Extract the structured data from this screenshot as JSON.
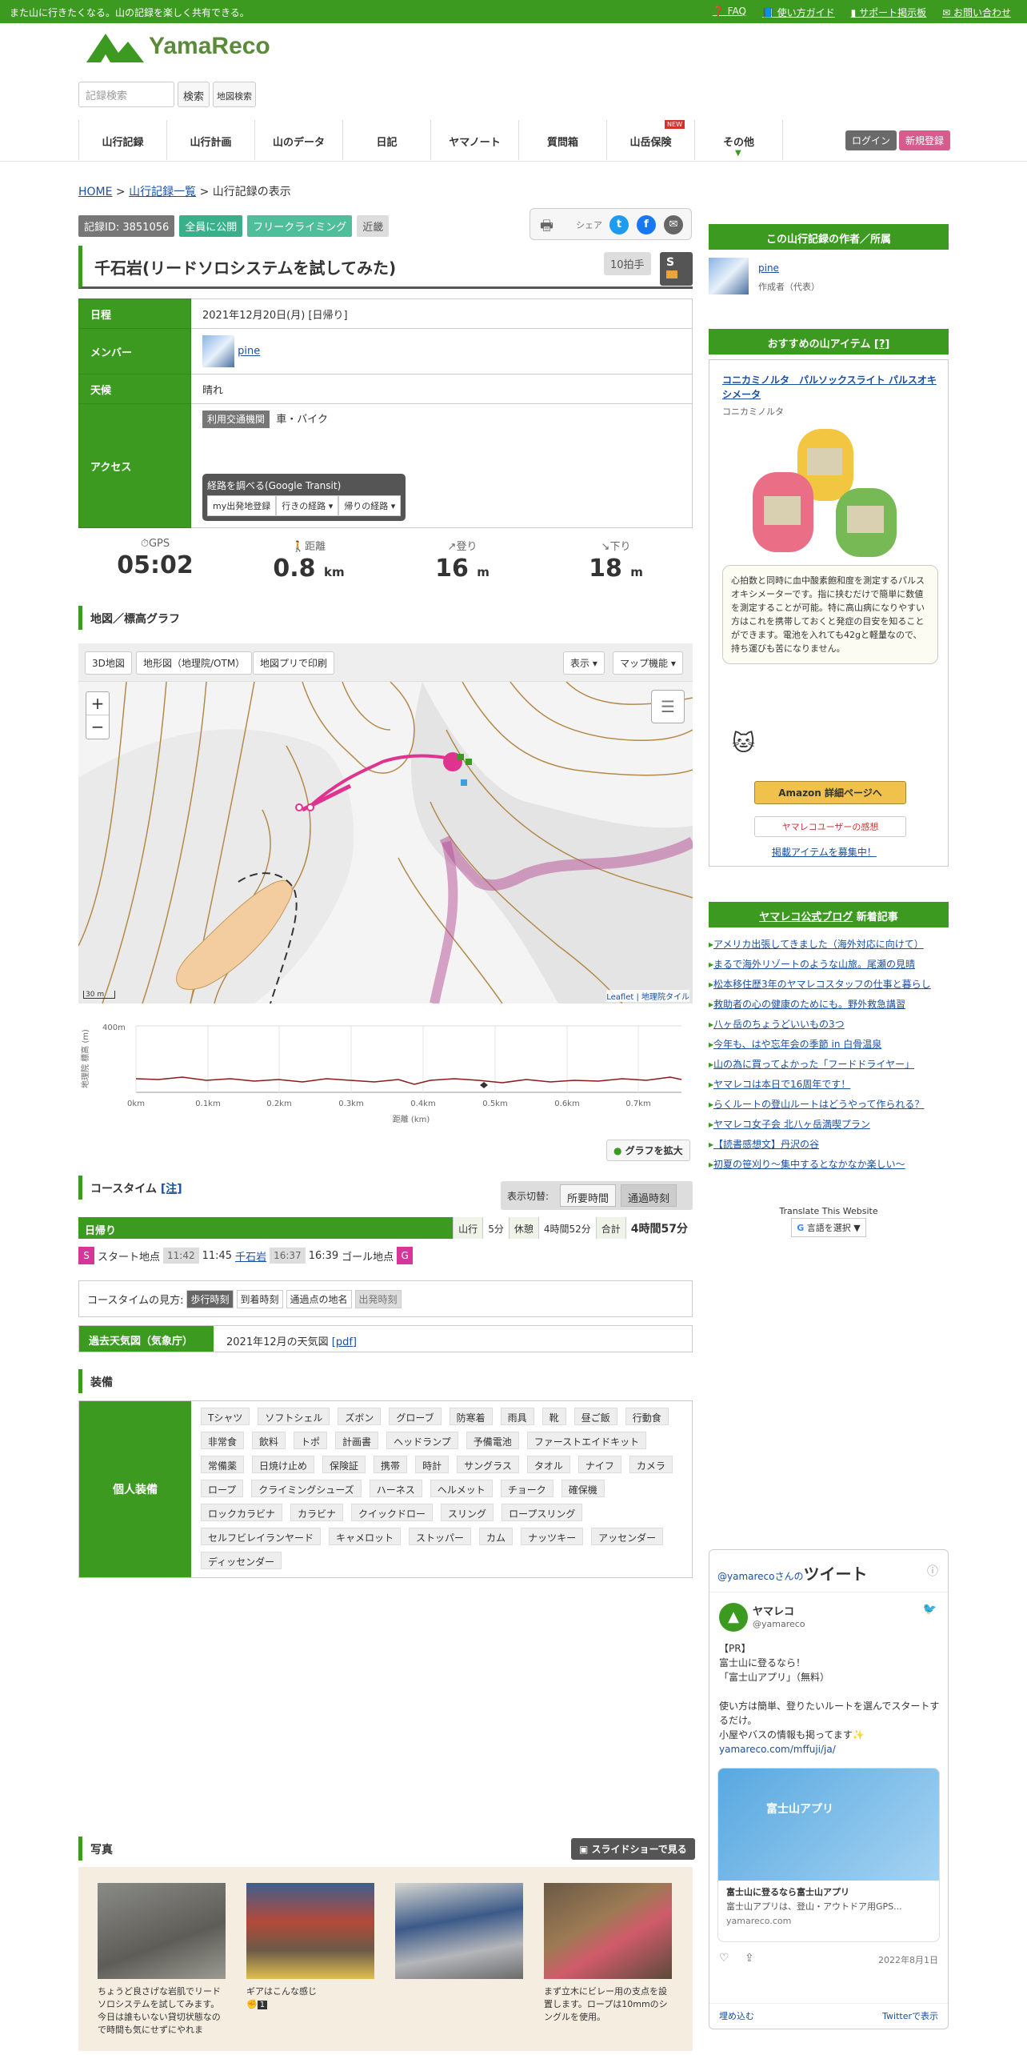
{
  "topbar": {
    "tagline": "また山に行きたくなる。山の記録を楽しく共有できる。",
    "faq": "FAQ",
    "guide": "使い方ガイド",
    "support": "サポート掲示板",
    "contact": "お問い合わせ"
  },
  "logo": "YamaReco",
  "search": {
    "placeholder": "記録検索",
    "button": "検索",
    "map": "地図検索"
  },
  "nav": [
    "山行記録",
    "山行計画",
    "山のデータ",
    "日記",
    "ヤマノート",
    "質問箱",
    "山岳保険",
    "その他"
  ],
  "nav_new": "NEW",
  "auth": {
    "login": "ログイン",
    "register": "新規登録"
  },
  "breadcrumb": {
    "home": "HOME",
    "list": "山行記録一覧",
    "current": "山行記録の表示"
  },
  "badges": {
    "id": "記録ID: 3851056",
    "public": "全員に公開",
    "category": "フリークライミング",
    "area": "近畿"
  },
  "share": {
    "label": "シェア"
  },
  "title": "千石岩(リードソロシステムを試してみた)",
  "grade": {
    "claps": "10拍手",
    "badge": "S"
  },
  "info": {
    "date_h": "日程",
    "date": "2021年12月20日(月) [日帰り]",
    "member_h": "メンバー",
    "member": "pine",
    "weather_h": "天候",
    "weather": "晴れ",
    "access_h": "アクセス",
    "transport_tag": "利用交通機関",
    "transport": "車・バイク",
    "transit_title": "経路を調べる(Google Transit)",
    "transit_btns": [
      "my出発地登録",
      "行きの経路 ▾",
      "帰りの経路 ▾"
    ]
  },
  "stats": [
    {
      "label": "GPS",
      "value": "05:02",
      "unit": ""
    },
    {
      "label": "距離",
      "value": "0.8",
      "unit": "km"
    },
    {
      "label": "登り",
      "value": "16",
      "unit": "m"
    },
    {
      "label": "下り",
      "value": "18",
      "unit": "m"
    }
  ],
  "map_section": "地図／標高グラフ",
  "map_tools": {
    "b3d": "3D地図",
    "topo": "地形図（地理院/OTM）",
    "print": "地図プリで印刷",
    "show": "表示 ▾",
    "func": "マップ機能 ▾",
    "scale": "30 m",
    "attr": "Leaflet | 地理院タイル"
  },
  "elevation": {
    "ylabel": "地理院 標高 (m)",
    "ymax": "400m",
    "xlabel": "距離 (km)",
    "xticks": [
      "0km",
      "0.1km",
      "0.2km",
      "0.3km",
      "0.4km",
      "0.5km",
      "0.6km",
      "0.7km"
    ],
    "expand": "グラフを拡大"
  },
  "course": {
    "title": "コースタイム",
    "note": "[注]",
    "toggle_label": "表示切替:",
    "opt1": "所要時間",
    "opt2": "通過時刻",
    "day": "日帰り",
    "walk": "山行",
    "walk_v": "5分",
    "rest": "休憩",
    "rest_v": "4時間52分",
    "total": "合計",
    "total_v": "4時間57分",
    "start": "スタート地点",
    "t1": "11:42",
    "t2": "11:45",
    "mid": "千石岩",
    "t3": "16:37",
    "t4": "16:39",
    "goal": "ゴール地点",
    "s": "S",
    "g": "G"
  },
  "legend": {
    "label": "コースタイムの見方:",
    "walk": "歩行時刻",
    "arrive": "到着時刻",
    "place": "通過点の地名",
    "depart": "出発時刻"
  },
  "past_weather": {
    "h": "過去天気図（気象庁）",
    "v": "2021年12月の天気図",
    "pdf": "[pdf]"
  },
  "equip": {
    "section": "装備",
    "h": "個人装備",
    "items": [
      "Tシャツ",
      "ソフトシェル",
      "ズボン",
      "グローブ",
      "防寒着",
      "雨具",
      "靴",
      "昼ご飯",
      "行動食",
      "非常食",
      "飲料",
      "トポ",
      "計画書",
      "ヘッドランプ",
      "予備電池",
      "ファーストエイドキット",
      "常備薬",
      "日焼け止め",
      "保険証",
      "携帯",
      "時計",
      "サングラス",
      "タオル",
      "ナイフ",
      "カメラ",
      "ロープ",
      "クライミングシューズ",
      "ハーネス",
      "ヘルメット",
      "チョーク",
      "確保機",
      "ロックカラビナ",
      "カラビナ",
      "クイックドロー",
      "スリング",
      "ロープスリング",
      "セルフビレイランヤード",
      "キャメロット",
      "ストッパー",
      "カム",
      "ナッツキー",
      "アッセンダー",
      "ディッセンダー"
    ]
  },
  "photos": {
    "section": "写真",
    "slideshow": "スライドショーで見る",
    "items": [
      {
        "cap": "ちょうど良さげな岩肌でリードソロシステムを試してみます。今日は誰もいない貸切状態なので時間も気にせずにやれま"
      },
      {
        "cap": "ギアはこんな感じ",
        "likes": "1"
      },
      {
        "cap": ""
      },
      {
        "cap": "まず立木にビレー用の支点を設置します。ロープは10mmのシングルを使用。"
      }
    ]
  },
  "side": {
    "author_h": "この山行記録の作者／所属",
    "author": "pine",
    "author_role": "作成者（代表）",
    "reco_h": "おすすめの山アイテム",
    "reco_q": "[?]",
    "item_name": "コニカミノルタ　パルソックスライト パルスオキシメータ",
    "maker": "コニカミノルタ",
    "desc": "心拍数と同時に血中酸素飽和度を測定するパルスオキシメーターです。指に挟むだけで簡単に数値を測定することが可能。特に高山病になりやすい方はこれを携帯しておくと発症の目安を知ることができます。電池を入れても42gと軽量なので、持ち運びも苦になりません。",
    "amazon": "Amazon 詳細ページへ",
    "review": "ヤマレコユーザーの感想",
    "recruit": "掲載アイテムを募集中！",
    "blog_h": "ヤマレコ公式ブログ",
    "blog_h2": "新着記事",
    "blog": [
      "アメリカ出張してきました（海外対応に向けて）",
      "まるで海外リゾートのような山旅。尾瀬の見晴",
      "松本移住歴3年のヤマレコスタッフの仕事と暮らし",
      "救助者の心の健康のためにも。野外救急講習",
      "八ヶ岳のちょうどいいもの3つ",
      "今年も、はや忘年会の季節 in 白骨温泉",
      "山の為に買ってよかった「フードドライヤー」",
      "ヤマレコは本日で16周年です！",
      "らくルートの登山ルートはどうやって作られる？",
      "ヤマレコ女子会 北八ヶ岳満喫プラン",
      "【読書感想文】丹沢の谷",
      "初夏の笹刈り～集中するとなかなか楽しい～"
    ],
    "translate": "Translate This Website",
    "lang": "言語を選択 ▼"
  },
  "tweet": {
    "head1": "@yamarecoさんの",
    "head2": "ツイート",
    "name": "ヤマレコ",
    "handle": "@yamareco",
    "pr": "【PR】",
    "l1": "富士山に登るなら！",
    "l2": "「富士山アプリ」（無料）",
    "l3": "使い方は簡単、登りたいルートを選んでスタートするだけ。",
    "l4": "小屋やバスの情報も掲ってます✨",
    "link": "yamareco.com/mffuji/ja/",
    "card_img": "富士山アプリ",
    "card_t": "富士山に登るなら富士山アプリ",
    "card_d": "富士山アプリは、登山・アウトドア用GPS...",
    "card_u": "yamareco.com",
    "date": "2022年8月1日",
    "embed": "埋め込む",
    "view": "Twitterで表示"
  },
  "colors": {
    "green": "#3b9a1f",
    "pink": "#d6359a",
    "teal": "#3ab08a"
  }
}
